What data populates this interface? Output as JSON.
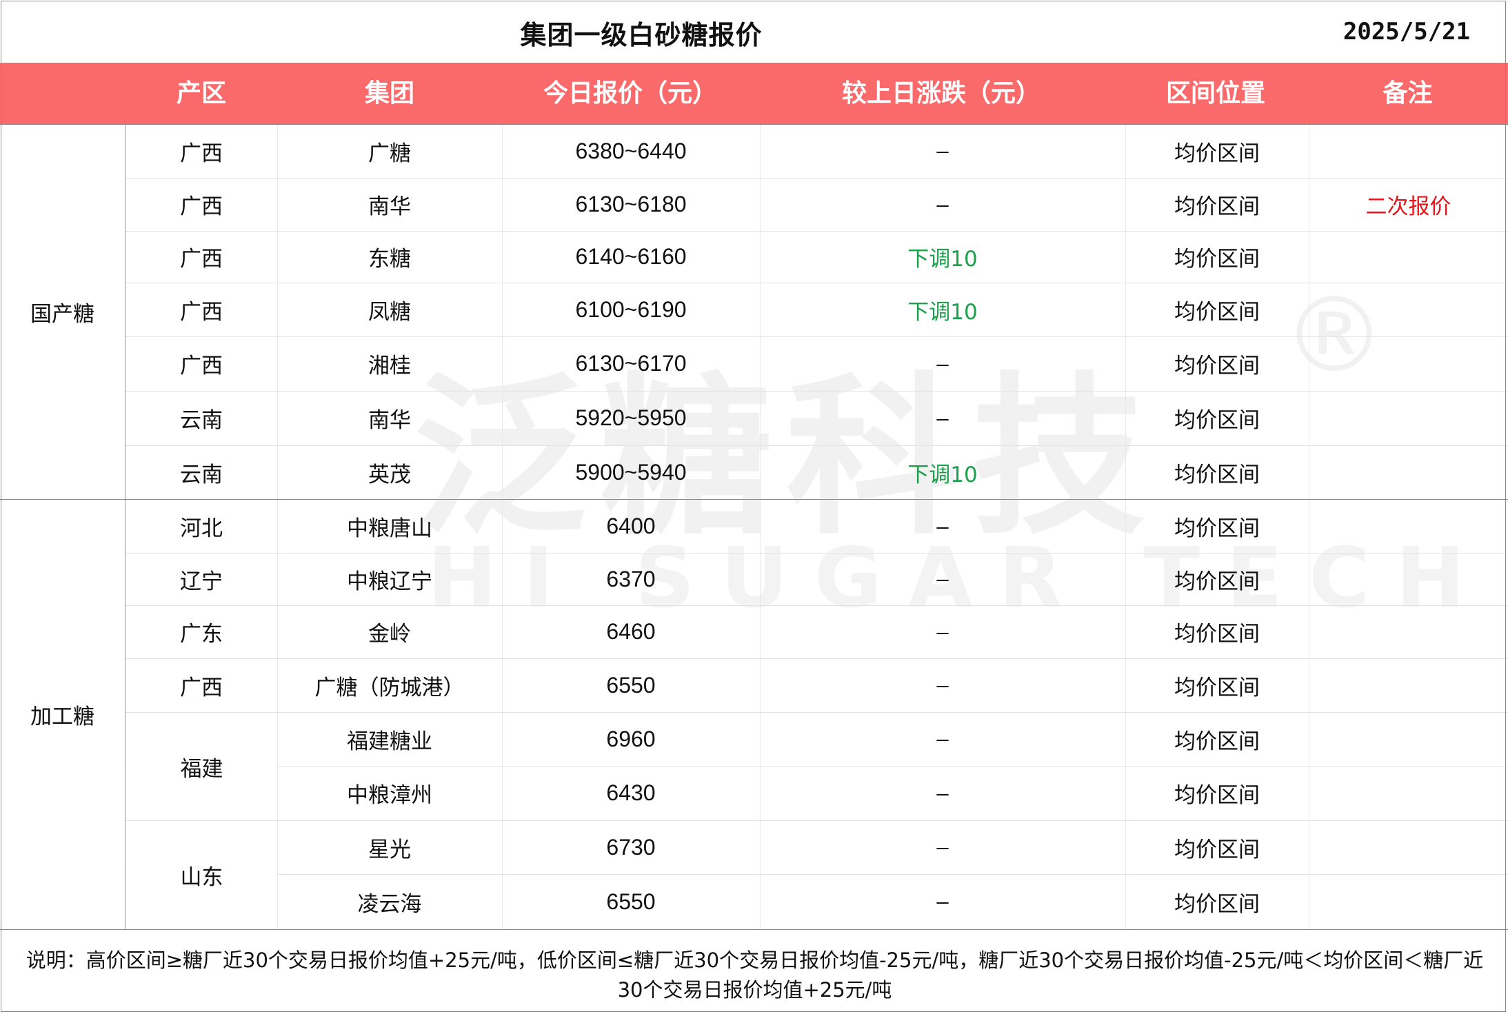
{
  "title": "集团一级白砂糖报价",
  "date": "2025/5/21",
  "header": {
    "columns": [
      "产区",
      "集团",
      "今日报价（元）",
      "较上日涨跌（元）",
      "区间位置",
      "备注"
    ]
  },
  "colors": {
    "header_bg": "#fa6a6a",
    "down_change": "#1aa04a",
    "remark_red": "#e8141b"
  },
  "sections": [
    {
      "name": "国产糖",
      "rows": [
        {
          "region": "广西",
          "group": "广糖",
          "price": "6380~6440",
          "change": "–",
          "position": "均价区间",
          "remark": ""
        },
        {
          "region": "广西",
          "group": "南华",
          "price": "6130~6180",
          "change": "–",
          "position": "均价区间",
          "remark": "二次报价"
        },
        {
          "region": "广西",
          "group": "东糖",
          "price": "6140~6160",
          "change": "下调10",
          "position": "均价区间",
          "remark": ""
        },
        {
          "region": "广西",
          "group": "凤糖",
          "price": "6100~6190",
          "change": "下调10",
          "position": "均价区间",
          "remark": ""
        },
        {
          "region": "广西",
          "group": "湘桂",
          "price": "6130~6170",
          "change": "–",
          "position": "均价区间",
          "remark": ""
        },
        {
          "region": "云南",
          "group": "南华",
          "price": "5920~5950",
          "change": "–",
          "position": "均价区间",
          "remark": ""
        },
        {
          "region": "云南",
          "group": "英茂",
          "price": "5900~5940",
          "change": "下调10",
          "position": "均价区间",
          "remark": ""
        }
      ]
    },
    {
      "name": "加工糖",
      "rows": [
        {
          "region": "河北",
          "group": "中粮唐山",
          "price": "6400",
          "change": "–",
          "position": "均价区间",
          "remark": ""
        },
        {
          "region": "辽宁",
          "group": "中粮辽宁",
          "price": "6370",
          "change": "–",
          "position": "均价区间",
          "remark": ""
        },
        {
          "region": "广东",
          "group": "金岭",
          "price": "6460",
          "change": "–",
          "position": "均价区间",
          "remark": ""
        },
        {
          "region": "广西",
          "group": "广糖（防城港）",
          "price": "6550",
          "change": "–",
          "position": "均价区间",
          "remark": ""
        },
        {
          "region": "福建",
          "group": "福建糖业",
          "price": "6960",
          "change": "–",
          "position": "均价区间",
          "remark": ""
        },
        {
          "region": "",
          "group": "中粮漳州",
          "price": "6430",
          "change": "–",
          "position": "均价区间",
          "remark": ""
        },
        {
          "region": "山东",
          "group": "星光",
          "price": "6730",
          "change": "–",
          "position": "均价区间",
          "remark": ""
        },
        {
          "region": "",
          "group": "凌云海",
          "price": "6550",
          "change": "–",
          "position": "均价区间",
          "remark": ""
        }
      ]
    }
  ],
  "footnote": "说明：高价区间≥糖厂近30个交易日报价均值+25元/吨，低价区间≤糖厂近30个交易日报价均值-25元/吨，糖厂近30个交易日报价均值-25元/吨＜均价区间＜糖厂近30个交易日报价均值+25元/吨",
  "watermark": {
    "cn": "泛糖科技",
    "en": "HI SUGAR TECH",
    "mark": "®"
  }
}
